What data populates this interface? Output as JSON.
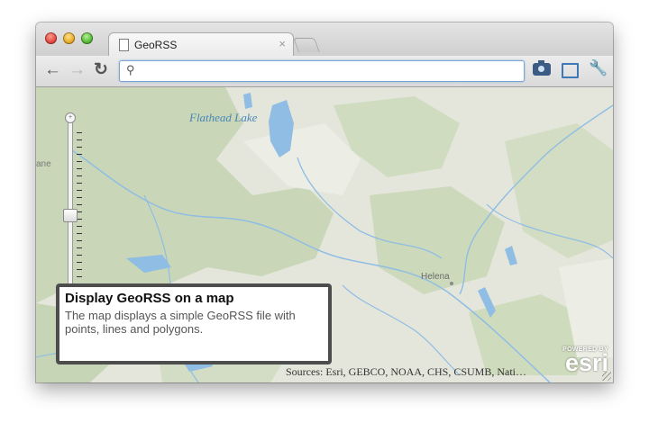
{
  "window": {
    "controls": [
      "close",
      "minimize",
      "zoom"
    ]
  },
  "tabs": [
    {
      "label": "GeoRSS",
      "icon": "page-icon",
      "close_glyph": "×"
    }
  ],
  "toolbar": {
    "back_glyph": "←",
    "forward_glyph": "→",
    "reload_glyph": "↻",
    "search_glyph": "⚲",
    "address_value": "",
    "address_placeholder": "",
    "wrench_glyph": "🔧",
    "extension_icons": [
      "camera-icon",
      "fullscreen-icon",
      "wrench-icon"
    ]
  },
  "map": {
    "labels": {
      "lake": "Flathead Lake",
      "city": "Helena",
      "edge": "ane"
    },
    "zoom_slider": {
      "plus_glyph": "+",
      "level_fraction": 0.55
    },
    "colors": {
      "land": "#e4e6dc",
      "forest": "#c9d7b8",
      "water": "#8fbde3"
    }
  },
  "info_panel": {
    "title": "Display GeoRSS on a map",
    "description": "The map displays a simple GeoRSS file with points, lines and polygons."
  },
  "attribution": "Sources: Esri, GEBCO, NOAA, CHS, CSUMB, Nati…",
  "logo": {
    "powered_by": "POWERED BY",
    "brand": "esri"
  }
}
